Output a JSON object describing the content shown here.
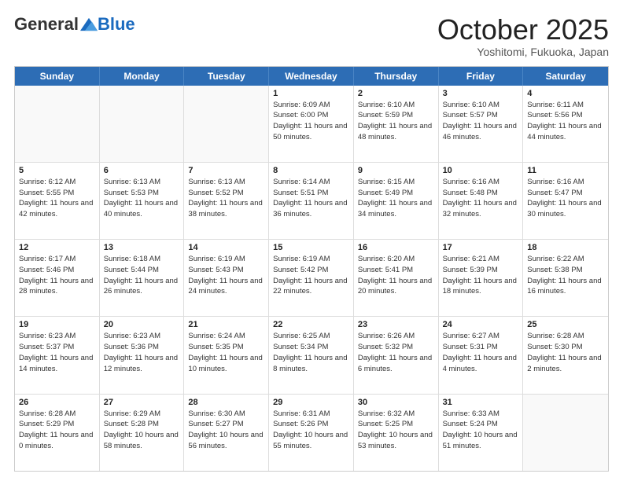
{
  "header": {
    "logo_general": "General",
    "logo_blue": "Blue",
    "month_title": "October 2025",
    "location": "Yoshitomi, Fukuoka, Japan"
  },
  "weekdays": [
    "Sunday",
    "Monday",
    "Tuesday",
    "Wednesday",
    "Thursday",
    "Friday",
    "Saturday"
  ],
  "rows": [
    [
      {
        "day": "",
        "sunrise": "",
        "sunset": "",
        "daylight": ""
      },
      {
        "day": "",
        "sunrise": "",
        "sunset": "",
        "daylight": ""
      },
      {
        "day": "",
        "sunrise": "",
        "sunset": "",
        "daylight": ""
      },
      {
        "day": "1",
        "sunrise": "Sunrise: 6:09 AM",
        "sunset": "Sunset: 6:00 PM",
        "daylight": "Daylight: 11 hours and 50 minutes."
      },
      {
        "day": "2",
        "sunrise": "Sunrise: 6:10 AM",
        "sunset": "Sunset: 5:59 PM",
        "daylight": "Daylight: 11 hours and 48 minutes."
      },
      {
        "day": "3",
        "sunrise": "Sunrise: 6:10 AM",
        "sunset": "Sunset: 5:57 PM",
        "daylight": "Daylight: 11 hours and 46 minutes."
      },
      {
        "day": "4",
        "sunrise": "Sunrise: 6:11 AM",
        "sunset": "Sunset: 5:56 PM",
        "daylight": "Daylight: 11 hours and 44 minutes."
      }
    ],
    [
      {
        "day": "5",
        "sunrise": "Sunrise: 6:12 AM",
        "sunset": "Sunset: 5:55 PM",
        "daylight": "Daylight: 11 hours and 42 minutes."
      },
      {
        "day": "6",
        "sunrise": "Sunrise: 6:13 AM",
        "sunset": "Sunset: 5:53 PM",
        "daylight": "Daylight: 11 hours and 40 minutes."
      },
      {
        "day": "7",
        "sunrise": "Sunrise: 6:13 AM",
        "sunset": "Sunset: 5:52 PM",
        "daylight": "Daylight: 11 hours and 38 minutes."
      },
      {
        "day": "8",
        "sunrise": "Sunrise: 6:14 AM",
        "sunset": "Sunset: 5:51 PM",
        "daylight": "Daylight: 11 hours and 36 minutes."
      },
      {
        "day": "9",
        "sunrise": "Sunrise: 6:15 AM",
        "sunset": "Sunset: 5:49 PM",
        "daylight": "Daylight: 11 hours and 34 minutes."
      },
      {
        "day": "10",
        "sunrise": "Sunrise: 6:16 AM",
        "sunset": "Sunset: 5:48 PM",
        "daylight": "Daylight: 11 hours and 32 minutes."
      },
      {
        "day": "11",
        "sunrise": "Sunrise: 6:16 AM",
        "sunset": "Sunset: 5:47 PM",
        "daylight": "Daylight: 11 hours and 30 minutes."
      }
    ],
    [
      {
        "day": "12",
        "sunrise": "Sunrise: 6:17 AM",
        "sunset": "Sunset: 5:46 PM",
        "daylight": "Daylight: 11 hours and 28 minutes."
      },
      {
        "day": "13",
        "sunrise": "Sunrise: 6:18 AM",
        "sunset": "Sunset: 5:44 PM",
        "daylight": "Daylight: 11 hours and 26 minutes."
      },
      {
        "day": "14",
        "sunrise": "Sunrise: 6:19 AM",
        "sunset": "Sunset: 5:43 PM",
        "daylight": "Daylight: 11 hours and 24 minutes."
      },
      {
        "day": "15",
        "sunrise": "Sunrise: 6:19 AM",
        "sunset": "Sunset: 5:42 PM",
        "daylight": "Daylight: 11 hours and 22 minutes."
      },
      {
        "day": "16",
        "sunrise": "Sunrise: 6:20 AM",
        "sunset": "Sunset: 5:41 PM",
        "daylight": "Daylight: 11 hours and 20 minutes."
      },
      {
        "day": "17",
        "sunrise": "Sunrise: 6:21 AM",
        "sunset": "Sunset: 5:39 PM",
        "daylight": "Daylight: 11 hours and 18 minutes."
      },
      {
        "day": "18",
        "sunrise": "Sunrise: 6:22 AM",
        "sunset": "Sunset: 5:38 PM",
        "daylight": "Daylight: 11 hours and 16 minutes."
      }
    ],
    [
      {
        "day": "19",
        "sunrise": "Sunrise: 6:23 AM",
        "sunset": "Sunset: 5:37 PM",
        "daylight": "Daylight: 11 hours and 14 minutes."
      },
      {
        "day": "20",
        "sunrise": "Sunrise: 6:23 AM",
        "sunset": "Sunset: 5:36 PM",
        "daylight": "Daylight: 11 hours and 12 minutes."
      },
      {
        "day": "21",
        "sunrise": "Sunrise: 6:24 AM",
        "sunset": "Sunset: 5:35 PM",
        "daylight": "Daylight: 11 hours and 10 minutes."
      },
      {
        "day": "22",
        "sunrise": "Sunrise: 6:25 AM",
        "sunset": "Sunset: 5:34 PM",
        "daylight": "Daylight: 11 hours and 8 minutes."
      },
      {
        "day": "23",
        "sunrise": "Sunrise: 6:26 AM",
        "sunset": "Sunset: 5:32 PM",
        "daylight": "Daylight: 11 hours and 6 minutes."
      },
      {
        "day": "24",
        "sunrise": "Sunrise: 6:27 AM",
        "sunset": "Sunset: 5:31 PM",
        "daylight": "Daylight: 11 hours and 4 minutes."
      },
      {
        "day": "25",
        "sunrise": "Sunrise: 6:28 AM",
        "sunset": "Sunset: 5:30 PM",
        "daylight": "Daylight: 11 hours and 2 minutes."
      }
    ],
    [
      {
        "day": "26",
        "sunrise": "Sunrise: 6:28 AM",
        "sunset": "Sunset: 5:29 PM",
        "daylight": "Daylight: 11 hours and 0 minutes."
      },
      {
        "day": "27",
        "sunrise": "Sunrise: 6:29 AM",
        "sunset": "Sunset: 5:28 PM",
        "daylight": "Daylight: 10 hours and 58 minutes."
      },
      {
        "day": "28",
        "sunrise": "Sunrise: 6:30 AM",
        "sunset": "Sunset: 5:27 PM",
        "daylight": "Daylight: 10 hours and 56 minutes."
      },
      {
        "day": "29",
        "sunrise": "Sunrise: 6:31 AM",
        "sunset": "Sunset: 5:26 PM",
        "daylight": "Daylight: 10 hours and 55 minutes."
      },
      {
        "day": "30",
        "sunrise": "Sunrise: 6:32 AM",
        "sunset": "Sunset: 5:25 PM",
        "daylight": "Daylight: 10 hours and 53 minutes."
      },
      {
        "day": "31",
        "sunrise": "Sunrise: 6:33 AM",
        "sunset": "Sunset: 5:24 PM",
        "daylight": "Daylight: 10 hours and 51 minutes."
      },
      {
        "day": "",
        "sunrise": "",
        "sunset": "",
        "daylight": ""
      }
    ]
  ]
}
